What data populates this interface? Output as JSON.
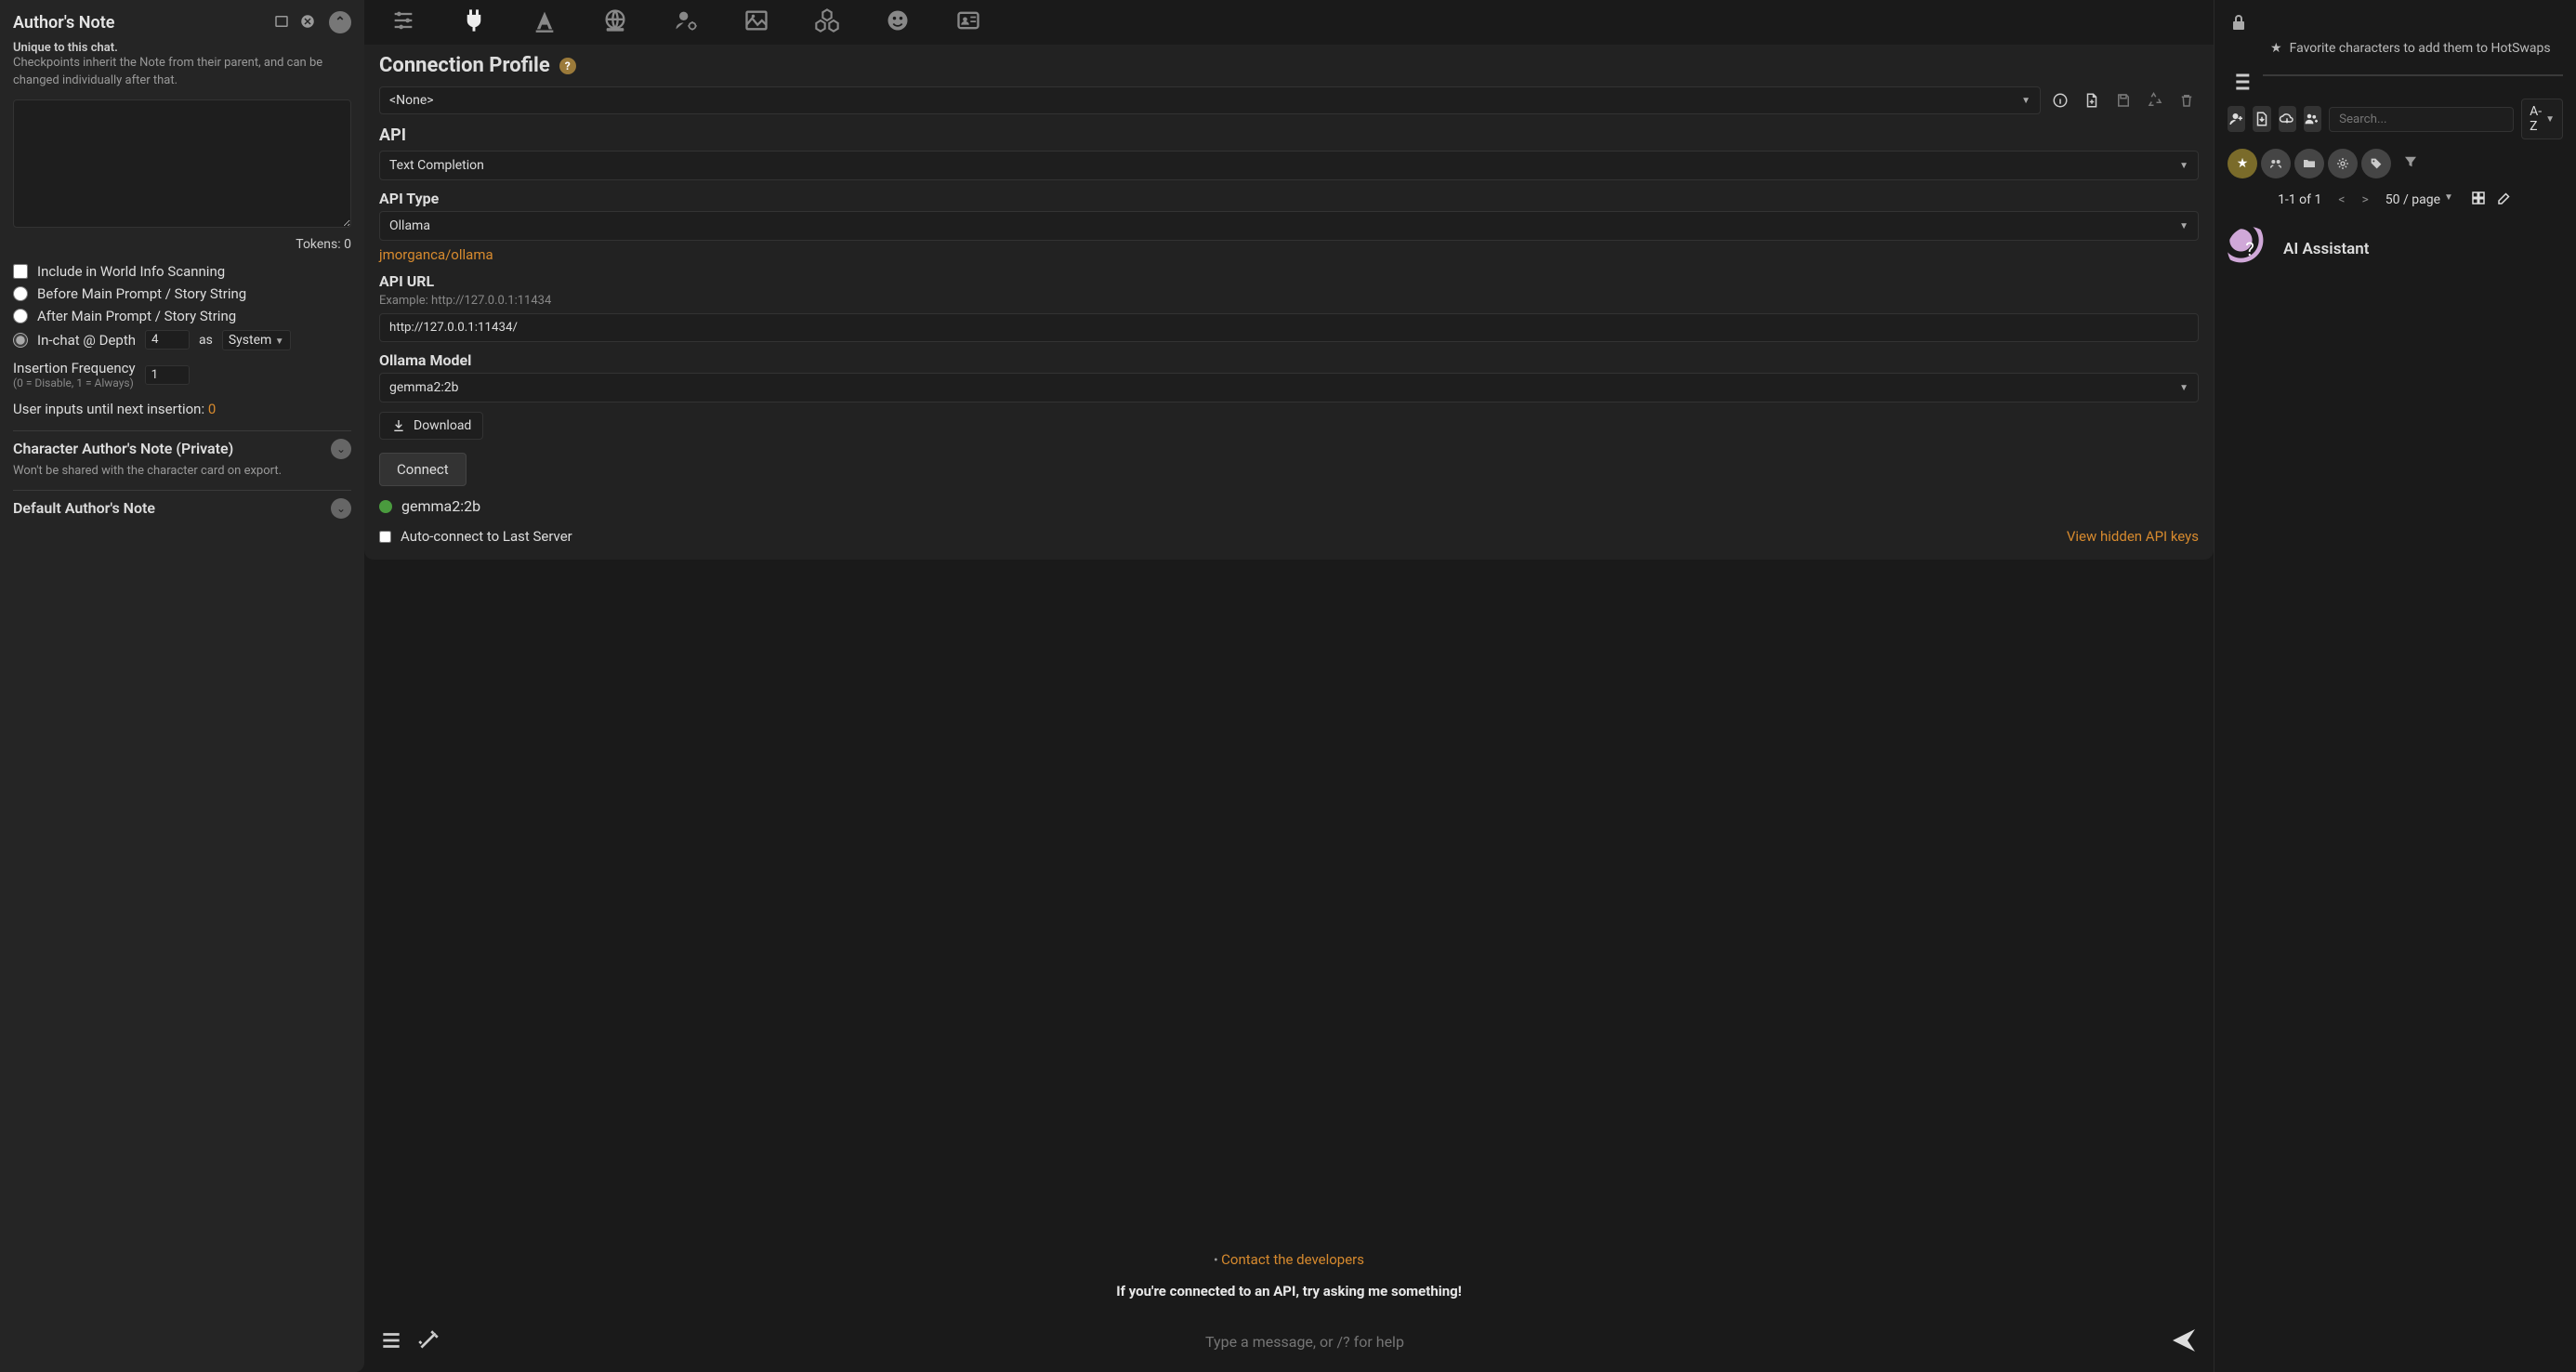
{
  "left": {
    "title": "Author's Note",
    "unique": "Unique to this chat.",
    "help": "Checkpoints inherit the Note from their parent, and can be changed individually after that.",
    "tokens_label": "Tokens: 0",
    "include_wi": "Include in World Info Scanning",
    "before_prompt": "Before Main Prompt / Story String",
    "after_prompt": "After Main Prompt / Story String",
    "inchat_label": "In-chat @ Depth",
    "depth_value": "4",
    "as_label": "as",
    "role_value": "System",
    "ins_freq_label": "Insertion Frequency",
    "ins_freq_hint": "(0 = Disable, 1 = Always)",
    "ins_freq_value": "1",
    "inputs_until": "User inputs until next insertion: ",
    "inputs_until_count": "0",
    "char_note_title": "Character Author's Note (Private)",
    "char_note_sub": "Won't be shared with the character card on export.",
    "default_note_title": "Default Author's Note"
  },
  "api": {
    "section_title": "Connection Profile",
    "profile_value": "<None>",
    "api_label": "API",
    "api_value": "Text Completion",
    "api_type_label": "API Type",
    "api_type_value": "Ollama",
    "repo_link": "jmorganca/ollama",
    "api_url_label": "API URL",
    "api_url_example": "Example: http://127.0.0.1:11434",
    "api_url_value": "http://127.0.0.1:11434/",
    "model_label": "Ollama Model",
    "model_value": "gemma2:2b",
    "download_label": "Download",
    "connect_label": "Connect",
    "status_model": "gemma2:2b",
    "auto_connect": "Auto-connect to Last Server",
    "view_keys": "View hidden API keys",
    "contact": "Contact the developers",
    "prompt_hint": "If you're connected to an API, try asking me something!",
    "msg_placeholder": "Type a message, or /? for help"
  },
  "right": {
    "fav_text": "Favorite characters to add them to HotSwaps",
    "search_placeholder": "Search...",
    "sort_value": "A-Z",
    "page_info": "1-1 of 1",
    "per_page": "50 / page",
    "char_name": "AI Assistant"
  }
}
